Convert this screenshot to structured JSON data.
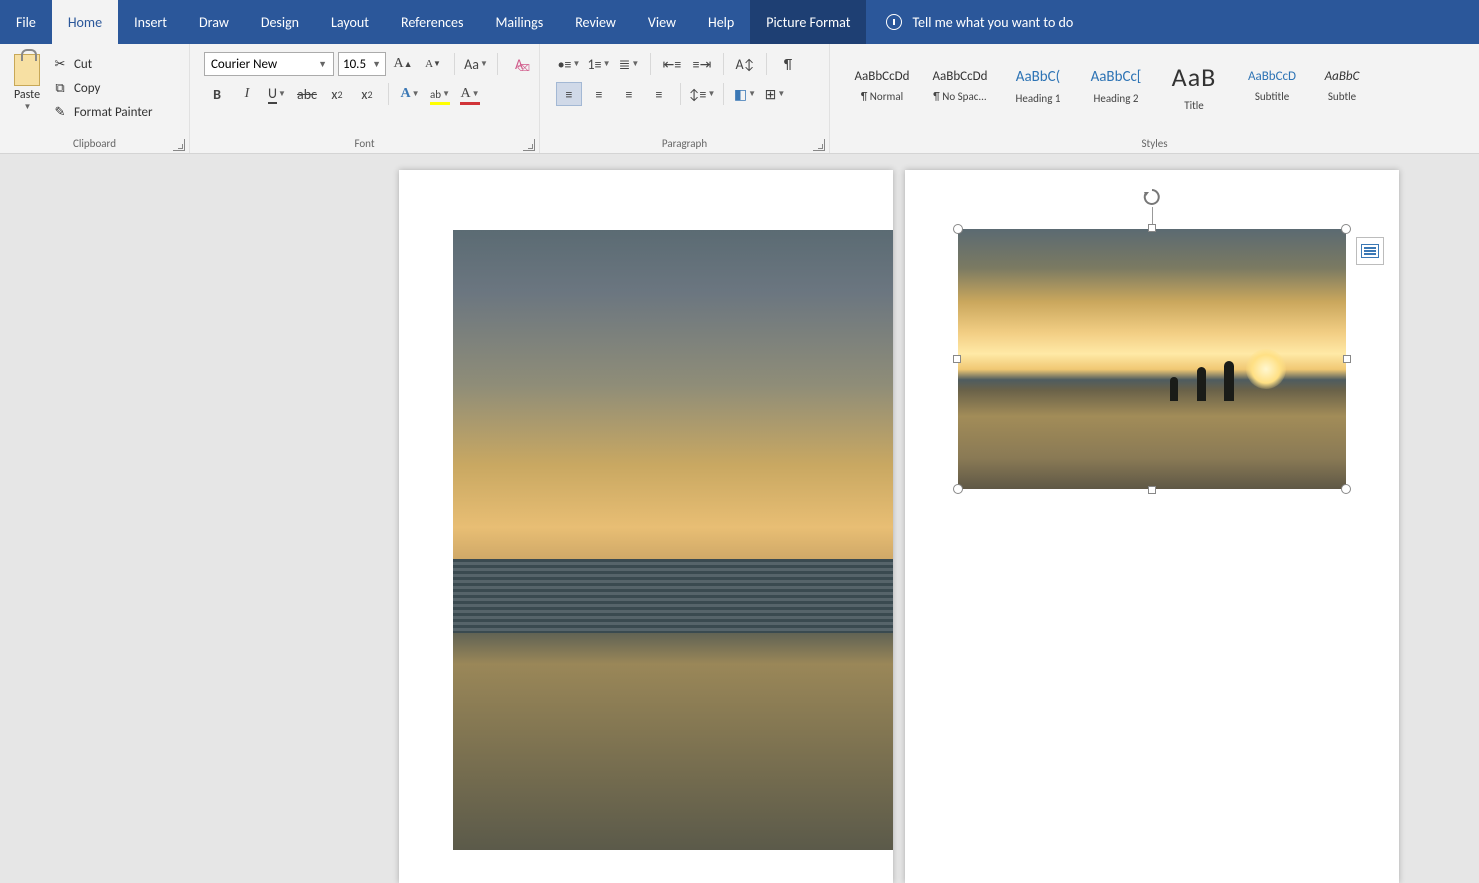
{
  "tabs": {
    "file": "File",
    "home": "Home",
    "insert": "Insert",
    "draw": "Draw",
    "design": "Design",
    "layout": "Layout",
    "references": "References",
    "mailings": "Mailings",
    "review": "Review",
    "view": "View",
    "help": "Help",
    "picture_format": "Picture Format"
  },
  "tell_me": "Tell me what you want to do",
  "clipboard": {
    "paste": "Paste",
    "cut": "Cut",
    "copy": "Copy",
    "format_painter": "Format Painter",
    "group": "Clipboard"
  },
  "font": {
    "name": "Courier New",
    "size": "10.5",
    "group": "Font"
  },
  "paragraph": {
    "group": "Paragraph"
  },
  "styles": {
    "group": "Styles",
    "items": [
      {
        "preview": "AaBbCcDd",
        "label": "¶ Normal",
        "cls": ""
      },
      {
        "preview": "AaBbCcDd",
        "label": "¶ No Spac...",
        "cls": ""
      },
      {
        "preview": "AaBbC(",
        "label": "Heading 1",
        "cls": "blue"
      },
      {
        "preview": "AaBbCc[",
        "label": "Heading 2",
        "cls": "blue"
      },
      {
        "preview": "AaB",
        "label": "Title",
        "cls": "title"
      },
      {
        "preview": "AaBbCcD",
        "label": "Subtitle",
        "cls": "blue"
      },
      {
        "preview": "AaBbC",
        "label": "Subtle",
        "cls": ""
      }
    ]
  }
}
